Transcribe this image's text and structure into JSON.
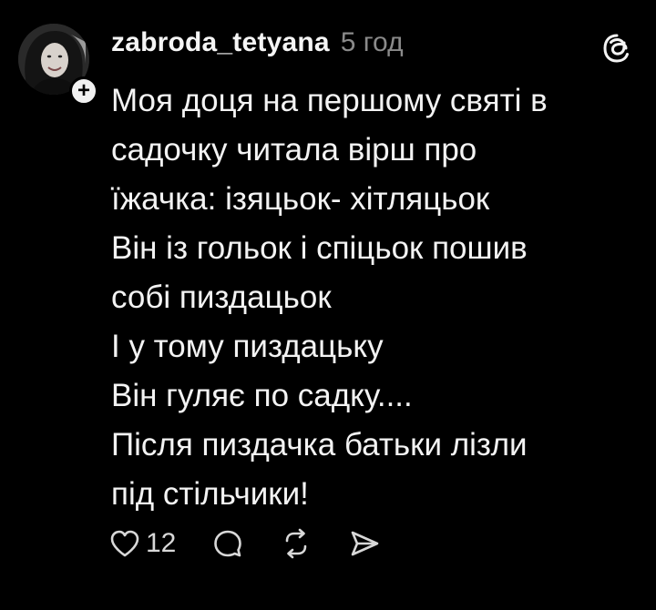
{
  "post": {
    "username": "zabroda_tetyana",
    "timestamp": "5 год",
    "avatar_icon": "profile-photo",
    "follow_badge": "+",
    "lines": [
      "Моя доця на першому святі в",
      "садочку читала вірш про",
      "їжачка: ізяцьок- хітляцьок",
      "Він із гольок і спіцьок пошив",
      "собі пиздацьок",
      "І у тому пиздацьку",
      "Він гуляє по садку....",
      "Після пиздачка батьки лізли",
      "під стільчики!"
    ],
    "likes": "12",
    "icons": [
      "heart-icon",
      "comment-icon",
      "repost-icon",
      "share-icon",
      "threads-logo-icon"
    ],
    "colors": {
      "background": "#000000",
      "text": "#f3f3f3",
      "timestamp": "#8a8a8a"
    }
  }
}
